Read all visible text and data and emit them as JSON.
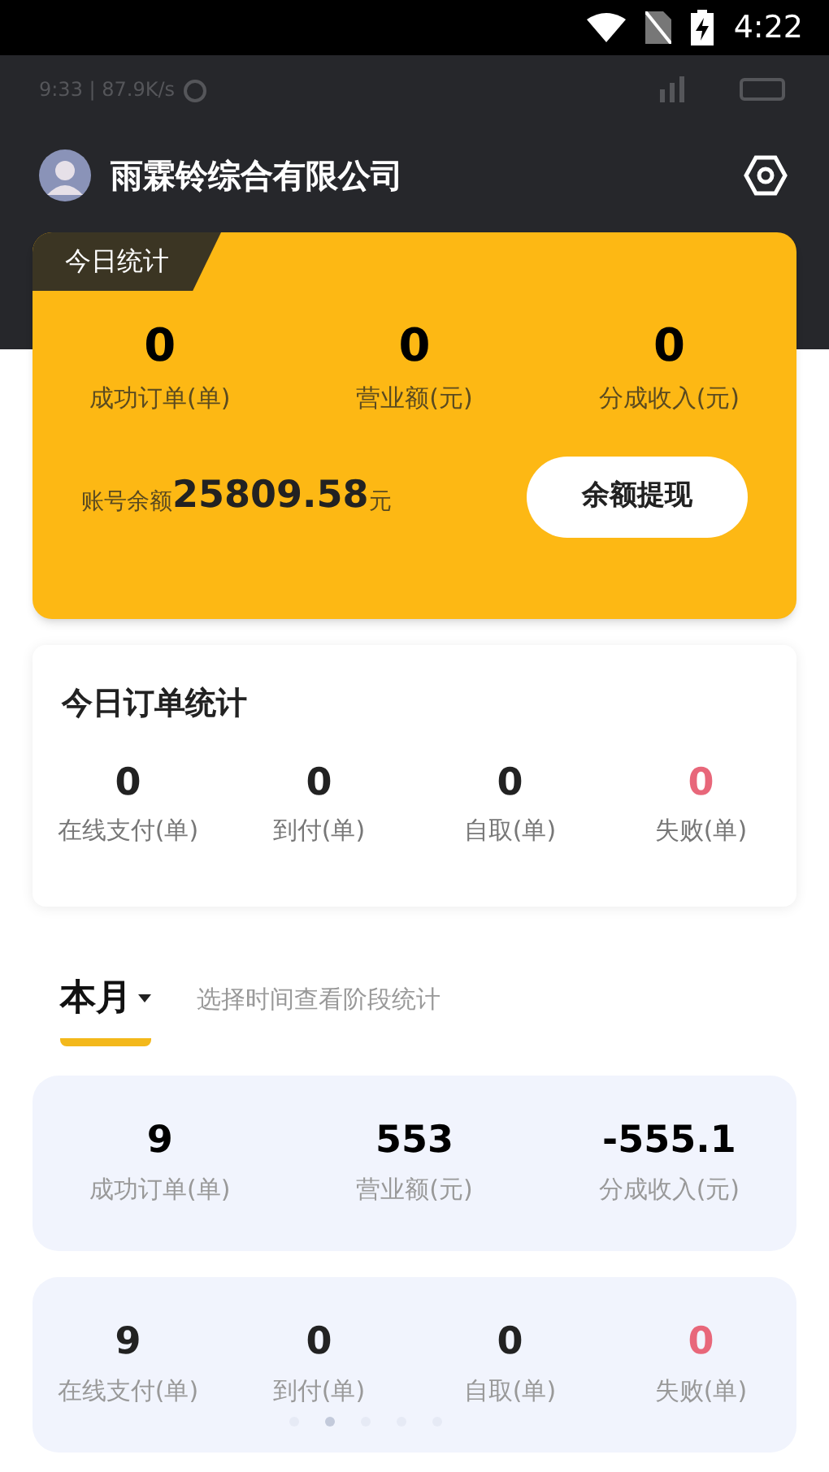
{
  "system_status": {
    "time": "4:22"
  },
  "inner_status": {
    "left": "9:33 | 87.9K/s"
  },
  "header": {
    "company": "雨霖铃综合有限公司"
  },
  "today_card": {
    "badge": "今日统计",
    "stats": [
      {
        "value": "0",
        "label": "成功订单(单)"
      },
      {
        "value": "0",
        "label": "营业额(元)"
      },
      {
        "value": "0",
        "label": "分成收入(元)"
      }
    ],
    "balance_label": "账号余额",
    "balance": "25809.58",
    "balance_unit": "元",
    "withdraw": "余额提现"
  },
  "order_card": {
    "title": "今日订单统计",
    "stats": [
      {
        "value": "0",
        "label": "在线支付(单)",
        "color": "#222222"
      },
      {
        "value": "0",
        "label": "到付(单)",
        "color": "#222222"
      },
      {
        "value": "0",
        "label": "自取(单)",
        "color": "#222222"
      },
      {
        "value": "0",
        "label": "失败(单)",
        "color": "#e8677a"
      }
    ]
  },
  "period": {
    "tab": "本月",
    "hint": "选择时间查看阶段统计"
  },
  "month_summary": [
    {
      "value": "9",
      "label": "成功订单(单)"
    },
    {
      "value": "553",
      "label": "营业额(元)"
    },
    {
      "value": "-555.1",
      "label": "分成收入(元)"
    }
  ],
  "month_orders": [
    {
      "value": "9",
      "label": "在线支付(单)",
      "color": "#222222"
    },
    {
      "value": "0",
      "label": "到付(单)",
      "color": "#222222"
    },
    {
      "value": "0",
      "label": "自取(单)",
      "color": "#222222"
    },
    {
      "value": "0",
      "label": "失败(单)",
      "color": "#e8677a"
    }
  ],
  "pager": [
    {
      "selected": false
    },
    {
      "selected": true
    },
    {
      "selected": false
    },
    {
      "selected": false
    },
    {
      "selected": false
    }
  ]
}
